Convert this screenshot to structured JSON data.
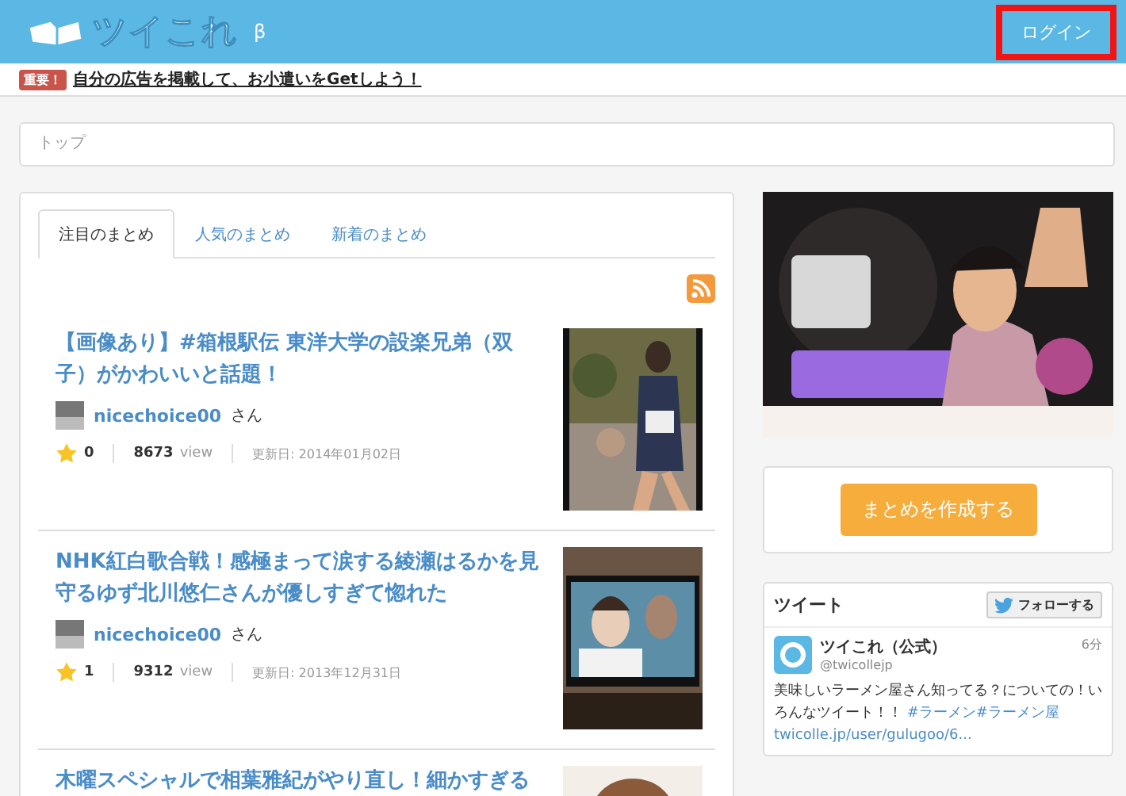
{
  "header": {
    "logo": "ツイこれ",
    "beta": "β",
    "login": {
      "label": "ログイン",
      "highlighted": true
    }
  },
  "notice": {
    "badge": "重要！",
    "text": "自分の広告を掲載して、お小遣いをGetしよう！"
  },
  "breadcrumb": "トップ",
  "tabs": [
    {
      "label": "注目のまとめ",
      "selected": true
    },
    {
      "label": "人気のまとめ",
      "selected": false
    },
    {
      "label": "新着のまとめ",
      "selected": false
    }
  ],
  "articles": [
    {
      "title": "【画像あり】#箱根駅伝 東洋大学の設楽兄弟（双子）がかわいいと話題！",
      "user": "nicechoice00",
      "suffix": "さん",
      "stars": "0",
      "views": "8673",
      "view_unit": "view",
      "updated": "更新日: 2014年01月02日"
    },
    {
      "title": "NHK紅白歌合戦！感極まって涙する綾瀬はるかを見守るゆず北川悠仁さんが優しすぎて惚れた",
      "user": "nicechoice00",
      "suffix": "さん",
      "stars": "1",
      "views": "9312",
      "view_unit": "view",
      "updated": "更新日: 2013年12月31日"
    },
    {
      "title": "木曜スペシャルで相葉雅紀がやり直し！細かすぎる"
    }
  ],
  "sidebar": {
    "create_button": "まとめを作成する",
    "tweets": {
      "title": "ツイート",
      "follow": "フォローする",
      "items": [
        {
          "name": "ツイこれ（公式）",
          "handle": "@twicollejp",
          "time": "6分",
          "text": "美味しいラーメン屋さん知ってる？についての！いろんなツイート！！",
          "tags": [
            "#ラーメン",
            "#ラーメン屋"
          ],
          "link": "twicolle.jp/user/gulugoo/6..."
        }
      ]
    }
  }
}
